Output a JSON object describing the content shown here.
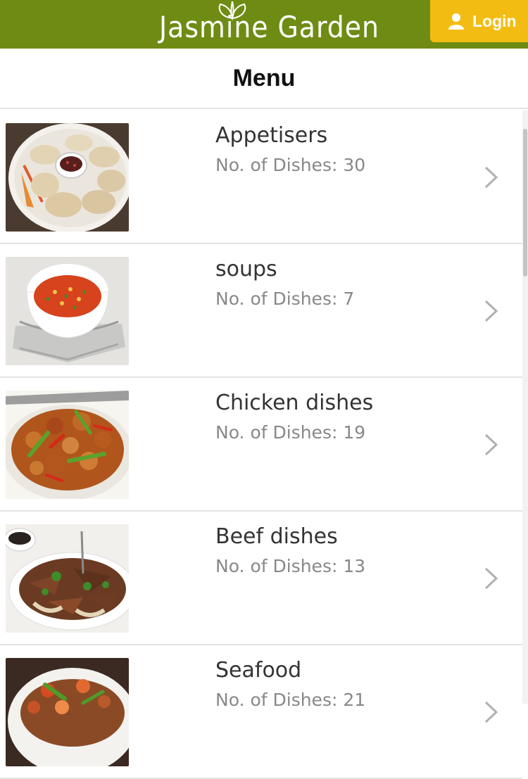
{
  "header": {
    "brand": "Jasmine Garden",
    "login_label": "Login",
    "colors": {
      "bar": "#6e8c14",
      "login": "#f3bc12"
    }
  },
  "menu": {
    "title": "Menu"
  },
  "categories": [
    {
      "name": "Appetisers",
      "count": "No. of Dishes: 30",
      "image": "dumplings-photo"
    },
    {
      "name": "soups",
      "count": "No. of Dishes: 7",
      "image": "soup-photo"
    },
    {
      "name": "Chicken dishes",
      "count": "No. of Dishes: 19",
      "image": "chicken-photo"
    },
    {
      "name": "Beef dishes",
      "count": "No. of Dishes: 13",
      "image": "beef-photo"
    },
    {
      "name": "Seafood",
      "count": "No. of Dishes: 21",
      "image": "seafood-photo"
    }
  ]
}
